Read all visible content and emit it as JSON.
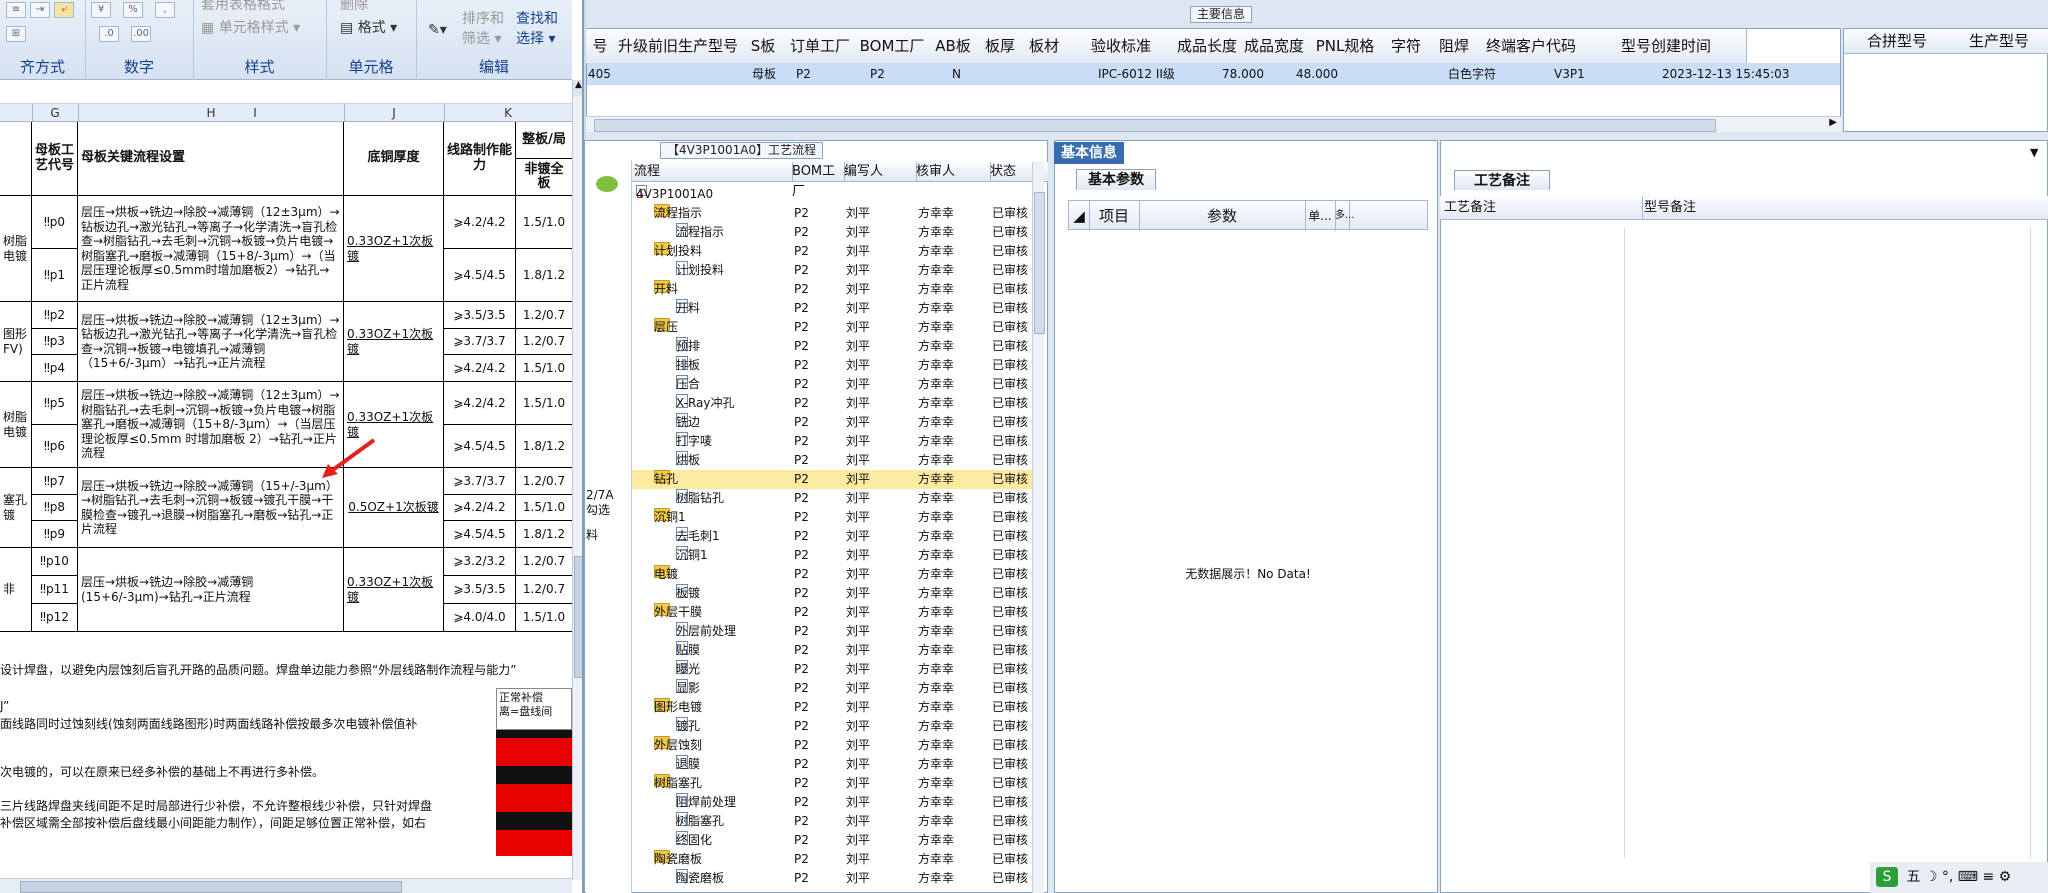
{
  "excel": {
    "ribbon": {
      "groups": [
        {
          "label": "齐方式"
        },
        {
          "label": "数字"
        },
        {
          "label": "样式"
        },
        {
          "label": "单元格"
        },
        {
          "label": "编辑"
        }
      ],
      "buttons": {
        "table_format": "套用表格格式",
        "cell_style": "单元格样式",
        "delete": "删除",
        "format": "格式",
        "sort_filter_1": "排序和",
        "sort_filter_2": "筛选",
        "find_select_1": "查找和",
        "find_select_2": "选择",
        "percent": "%"
      }
    },
    "columns": [
      "G",
      "H",
      "I",
      "J",
      "K"
    ],
    "header": {
      "mother_code": "母板工艺代号",
      "flow": "母板关键流程设置",
      "copper": "底铜厚度",
      "capability": "线路制作能力",
      "whole": "整板/局",
      "non_plated": "非镀全板"
    },
    "rows": [
      {
        "prefix": "树脂\n电镀",
        "codes": [
          "‼p0",
          "‼p1"
        ],
        "flow": "层压→烘板→铣边→除胶→减薄铜（12±3μm）→钻板边孔→激光钻孔→等离子→化学清洗→盲孔检查→树脂钻孔→去毛刺→沉铜→板镀→负片电镀→树脂塞孔→磨板→减薄铜（15+8/-3μm）→（当层压理论板厚≤0.5mm时增加磨板2）→钻孔→正片流程",
        "copper": "0.33OZ+1次板镀",
        "cap": [
          "⩾4.2/4.2",
          "⩾4.5/4.5"
        ],
        "whole": [
          "1.5/1.0",
          "1.8/1.2"
        ]
      },
      {
        "prefix": "图形\nFV)",
        "codes": [
          "‼p2",
          "‼p3",
          "‼p4"
        ],
        "flow": "层压→烘板→铣边→除胶→减薄铜（12±3μm）→钻板边孔→激光钻孔→等离子→化学清洗→盲孔检查→沉铜→板镀→电镀填孔→减薄铜（15+6/-3μm）→钻孔→正片流程",
        "copper": "0.33OZ+1次板镀",
        "cap": [
          "⩾3.5/3.5",
          "⩾3.7/3.7",
          "⩾4.2/4.2"
        ],
        "whole": [
          "1.2/0.7",
          "1.2/0.7",
          "1.5/1.0"
        ]
      },
      {
        "prefix": "树脂\n电镀",
        "codes": [
          "‼p5",
          "‼p6"
        ],
        "flow": "层压→烘板→铣边→除胶→减薄铜（12±3μm）→树脂钻孔→去毛刺→沉铜→板镀→负片电镀→树脂塞孔→磨板→减薄铜（15+8/-3μm）→（当层压理论板厚≤0.5mm 时增加磨板 2）→钻孔→正片流程",
        "copper": "0.33OZ+1次板镀",
        "cap": [
          "⩾4.2/4.2",
          "⩾4.5/4.5"
        ],
        "whole": [
          "1.5/1.0",
          "1.8/1.2"
        ]
      },
      {
        "prefix": "塞孔\n镀",
        "codes": [
          "‼p7",
          "‼p8",
          "‼p9"
        ],
        "flow": "层压→烘板→铣边→除胶→减薄铜（15+/-3μm）→树脂钻孔→去毛刺→沉铜→板镀→镀孔干膜→干膜检查→镀孔→退膜→树脂塞孔→磨板→钻孔→正片流程",
        "copper": "0.5OZ+1次板镀",
        "cap": [
          "⩾3.7/3.7",
          "⩾4.2/4.2",
          "⩾4.5/4.5"
        ],
        "whole": [
          "1.2/0.7",
          "1.5/1.0",
          "1.8/1.2"
        ]
      },
      {
        "prefix": "非",
        "codes": [
          "‼p10",
          "‼p11",
          "‼p12"
        ],
        "flow": "层压→烘板→铣边→除胶→减薄铜(15+6/-3μm)→钻孔→正片流程",
        "copper": "0.33OZ+1次板镀",
        "cap": [
          "⩾3.2/3.2",
          "⩾3.5/3.5",
          "⩾4.0/4.0"
        ],
        "whole": [
          "1.2/0.7",
          "1.2/0.7",
          "1.5/1.0"
        ]
      }
    ],
    "notes": [
      "设计焊盘，以避免内层蚀刻后盲孔开路的品质问题。焊盘单边能力参照“外层线路制作流程与能力”",
      "J”",
      "面线路同时过蚀刻线(蚀刻两面线路图形)时两面线路补偿按最多次电镀补偿值补",
      "次电镀的，可以在原来已经多补偿的基础上不再进行多补偿。",
      "三片线路焊盘夹线间距不足时局部进行少补偿，不允许整根线少补偿，只针对焊盘",
      "补偿区域需全部按补偿后盘线最小间距能力制作），间距足够位置正常补偿，如右"
    ],
    "inset_text": [
      "正常补偿",
      "离=盘线间"
    ]
  },
  "main_panel": {
    "title": "主要信息",
    "columns": [
      "号",
      "升级前旧生产型号",
      "S板",
      "订单工厂",
      "BOM工厂",
      "AB板",
      "板厚",
      "板材",
      "验收标准",
      "成品长度",
      "成品宽度",
      "PNL规格",
      "字符",
      "阻焊",
      "终端客户代码",
      "型号创建时间"
    ],
    "row": {
      "no": "405",
      "s_board": "母板",
      "order_factory": "P2",
      "bom_factory": "P2",
      "ab": "N",
      "standard": "IPC-6012 II级",
      "length": "78.000",
      "width": "48.000",
      "char": "白色字符",
      "customer": "V3P1",
      "created": "2023-12-13 15:45:03"
    },
    "side_columns": [
      "合拼型号",
      "生产型号"
    ]
  },
  "process_panel": {
    "title": "【4V3P1001A0】工艺流程",
    "columns": [
      "流程",
      "BOM工厂",
      "编写人",
      "核审人",
      "状态"
    ],
    "left_strip": [
      "2/7A",
      "勾选",
      "料"
    ],
    "root": "4V3P1001A0",
    "items": [
      {
        "name": "流程指示",
        "level": 1,
        "factory": "P2",
        "writer": "刘平",
        "checker": "方幸幸",
        "status": "已审核"
      },
      {
        "name": "流程指示",
        "level": 2,
        "factory": "P2",
        "writer": "刘平",
        "checker": "方幸幸",
        "status": "已审核"
      },
      {
        "name": "计划投料",
        "level": 1,
        "factory": "P2",
        "writer": "刘平",
        "checker": "方幸幸",
        "status": "已审核"
      },
      {
        "name": "计划投料",
        "level": 2,
        "factory": "P2",
        "writer": "刘平",
        "checker": "方幸幸",
        "status": "已审核"
      },
      {
        "name": "开料",
        "level": 1,
        "factory": "P2",
        "writer": "刘平",
        "checker": "方幸幸",
        "status": "已审核"
      },
      {
        "name": "开料",
        "level": 2,
        "factory": "P2",
        "writer": "刘平",
        "checker": "方幸幸",
        "status": "已审核"
      },
      {
        "name": "层压",
        "level": 1,
        "factory": "P2",
        "writer": "刘平",
        "checker": "方幸幸",
        "status": "已审核"
      },
      {
        "name": "预排",
        "level": 2,
        "factory": "P2",
        "writer": "刘平",
        "checker": "方幸幸",
        "status": "已审核"
      },
      {
        "name": "排板",
        "level": 2,
        "factory": "P2",
        "writer": "刘平",
        "checker": "方幸幸",
        "status": "已审核"
      },
      {
        "name": "压合",
        "level": 2,
        "factory": "P2",
        "writer": "刘平",
        "checker": "方幸幸",
        "status": "已审核"
      },
      {
        "name": "X-Ray冲孔",
        "level": 2,
        "factory": "P2",
        "writer": "刘平",
        "checker": "方幸幸",
        "status": "已审核"
      },
      {
        "name": "铣边",
        "level": 2,
        "factory": "P2",
        "writer": "刘平",
        "checker": "方幸幸",
        "status": "已审核"
      },
      {
        "name": "打字唛",
        "level": 2,
        "factory": "P2",
        "writer": "刘平",
        "checker": "方幸幸",
        "status": "已审核"
      },
      {
        "name": "烘板",
        "level": 2,
        "factory": "P2",
        "writer": "刘平",
        "checker": "方幸幸",
        "status": "已审核"
      },
      {
        "name": "钻孔",
        "level": 1,
        "factory": "P2",
        "writer": "刘平",
        "checker": "方幸幸",
        "status": "已审核",
        "selected": true
      },
      {
        "name": "树脂钻孔",
        "level": 2,
        "factory": "P2",
        "writer": "刘平",
        "checker": "方幸幸",
        "status": "已审核"
      },
      {
        "name": "沉铜1",
        "level": 1,
        "factory": "P2",
        "writer": "刘平",
        "checker": "方幸幸",
        "status": "已审核"
      },
      {
        "name": "去毛刺1",
        "level": 2,
        "factory": "P2",
        "writer": "刘平",
        "checker": "方幸幸",
        "status": "已审核"
      },
      {
        "name": "沉铜1",
        "level": 2,
        "factory": "P2",
        "writer": "刘平",
        "checker": "方幸幸",
        "status": "已审核"
      },
      {
        "name": "电镀",
        "level": 1,
        "factory": "P2",
        "writer": "刘平",
        "checker": "方幸幸",
        "status": "已审核"
      },
      {
        "name": "板镀",
        "level": 2,
        "factory": "P2",
        "writer": "刘平",
        "checker": "方幸幸",
        "status": "已审核"
      },
      {
        "name": "外层干膜",
        "level": 1,
        "factory": "P2",
        "writer": "刘平",
        "checker": "方幸幸",
        "status": "已审核"
      },
      {
        "name": "外层前处理",
        "level": 2,
        "factory": "P2",
        "writer": "刘平",
        "checker": "方幸幸",
        "status": "已审核"
      },
      {
        "name": "贴膜",
        "level": 2,
        "factory": "P2",
        "writer": "刘平",
        "checker": "方幸幸",
        "status": "已审核"
      },
      {
        "name": "曝光",
        "level": 2,
        "factory": "P2",
        "writer": "刘平",
        "checker": "方幸幸",
        "status": "已审核"
      },
      {
        "name": "显影",
        "level": 2,
        "factory": "P2",
        "writer": "刘平",
        "checker": "方幸幸",
        "status": "已审核"
      },
      {
        "name": "图形电镀",
        "level": 1,
        "factory": "P2",
        "writer": "刘平",
        "checker": "方幸幸",
        "status": "已审核"
      },
      {
        "name": "镀孔",
        "level": 2,
        "factory": "P2",
        "writer": "刘平",
        "checker": "方幸幸",
        "status": "已审核"
      },
      {
        "name": "外层蚀刻",
        "level": 1,
        "factory": "P2",
        "writer": "刘平",
        "checker": "方幸幸",
        "status": "已审核"
      },
      {
        "name": "退膜",
        "level": 2,
        "factory": "P2",
        "writer": "刘平",
        "checker": "方幸幸",
        "status": "已审核"
      },
      {
        "name": "树脂塞孔",
        "level": 1,
        "factory": "P2",
        "writer": "刘平",
        "checker": "方幸幸",
        "status": "已审核"
      },
      {
        "name": "阻焊前处理",
        "level": 2,
        "factory": "P2",
        "writer": "刘平",
        "checker": "方幸幸",
        "status": "已审核"
      },
      {
        "name": "树脂塞孔",
        "level": 2,
        "factory": "P2",
        "writer": "刘平",
        "checker": "方幸幸",
        "status": "已审核"
      },
      {
        "name": "终固化",
        "level": 2,
        "factory": "P2",
        "writer": "刘平",
        "checker": "方幸幸",
        "status": "已审核"
      },
      {
        "name": "陶瓷磨板",
        "level": 1,
        "factory": "P2",
        "writer": "刘平",
        "checker": "方幸幸",
        "status": "已审核"
      },
      {
        "name": "陶瓷磨板",
        "level": 2,
        "factory": "P2",
        "writer": "刘平",
        "checker": "方幸幸",
        "status": "已审核"
      }
    ]
  },
  "basic_panel": {
    "tab": "基本信息",
    "subtab": "基本参数",
    "columns": [
      "项目",
      "参数",
      "单...",
      "多..."
    ],
    "empty": "无数据展示！No Data!"
  },
  "craft_panel": {
    "tab": "工艺备注",
    "columns": [
      "工艺备注",
      "型号备注"
    ]
  },
  "taskbar": {
    "ime": "五",
    "glyphs": "☽ °, ⌨ ≡ ⚙"
  },
  "colors": {
    "accent": "#3a6db0",
    "selected_row": "#fbeaa0",
    "arrow": "#e8201a",
    "grid_hl": "#c9ddf6"
  }
}
